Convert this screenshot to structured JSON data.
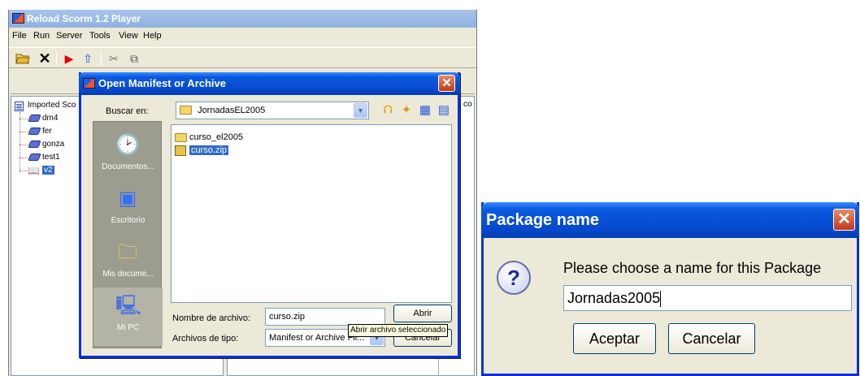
{
  "main_window": {
    "title": "Reload Scorm 1.2 Player",
    "menu": [
      "File",
      "Run",
      "Server",
      "Tools",
      "View",
      "Help"
    ],
    "toolbar_icons": [
      "open-folder-icon",
      "close-x-icon",
      "play-icon",
      "upload-arrow-icon",
      "tools-icon",
      "window-icon"
    ],
    "tree": {
      "root_label": "Imported Sco",
      "items": [
        "dm4",
        "fer",
        "gonza",
        "test1",
        "v2"
      ]
    },
    "right_label_partial": "co"
  },
  "open_dialog": {
    "title": "Open Manifest or Archive",
    "look_in_label": "Buscar en:",
    "look_in_value": "JornadasEL2005",
    "places": [
      "Documentos...",
      "Escritorio",
      "Mis docume...",
      "Mi PC"
    ],
    "files": [
      {
        "name": "curso_el2005",
        "type": "folder",
        "selected": false
      },
      {
        "name": "curso.zip",
        "type": "zip",
        "selected": true
      }
    ],
    "filename_label": "Nombre de archivo:",
    "filename_value": "curso.zip",
    "filetype_label": "Archivos de tipo:",
    "filetype_value": "Manifest or Archive Fil...",
    "open_button": "Abrir",
    "cancel_button": "Cancelar",
    "tooltip": "Abrir archivo seleccionado"
  },
  "package_dialog": {
    "title": "Package name",
    "prompt": "Please choose a name for this Package",
    "input_value": "Jornadas2005",
    "accept_button": "Aceptar",
    "cancel_button": "Cancelar"
  },
  "colors": {
    "xp_title_blue": "#0747c8",
    "dialog_bg": "#ece9d8",
    "selection_blue": "#316ac5"
  }
}
